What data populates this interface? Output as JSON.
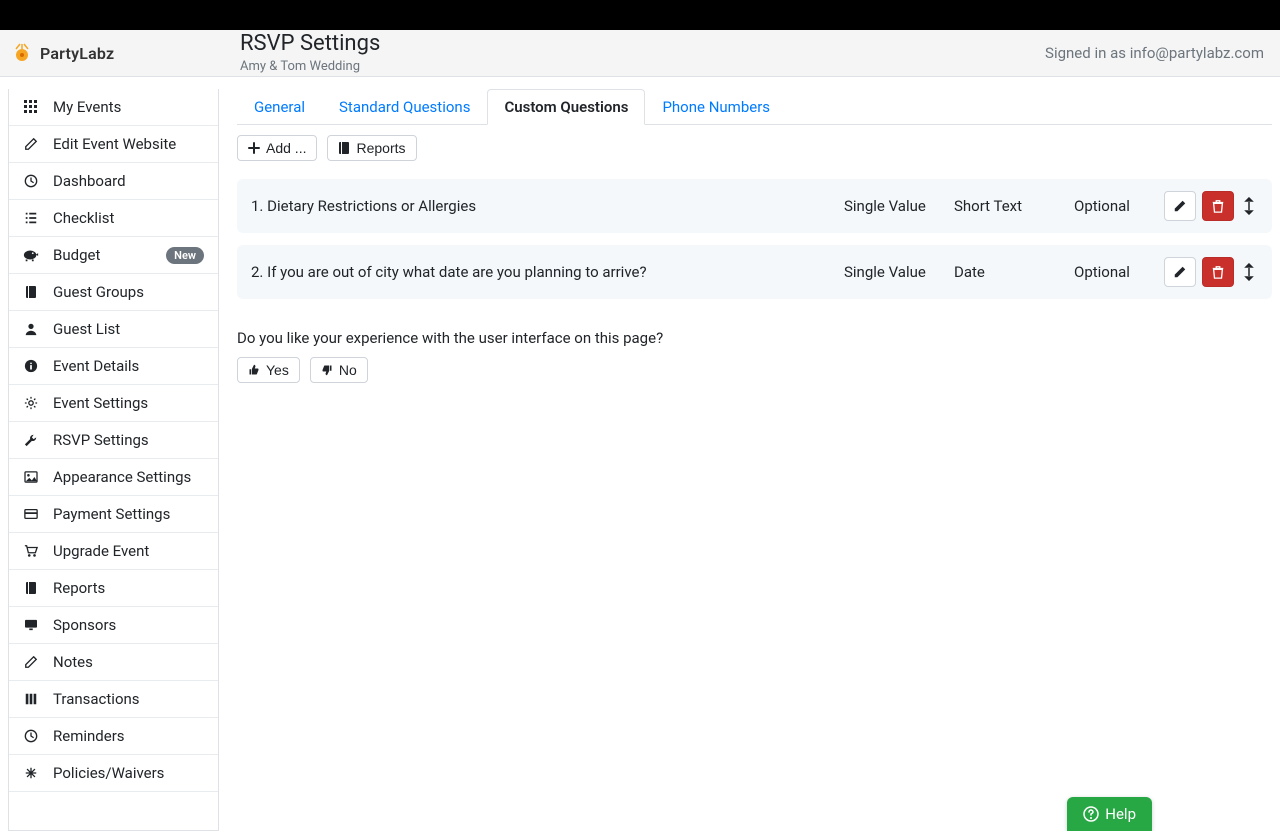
{
  "brand": {
    "name": "PartyLabz"
  },
  "header": {
    "title": "RSVP Settings",
    "event": "Amy & Tom Wedding",
    "signed_in": "Signed in as info@partylabz.com"
  },
  "sidebar": {
    "items": [
      {
        "label": "My Events",
        "icon": "grid-icon"
      },
      {
        "label": "Edit Event Website",
        "icon": "edit-icon"
      },
      {
        "label": "Dashboard",
        "icon": "clock-icon"
      },
      {
        "label": "Checklist",
        "icon": "list-icon"
      },
      {
        "label": "Budget",
        "icon": "piggy-icon",
        "badge": "New"
      },
      {
        "label": "Guest Groups",
        "icon": "book-icon"
      },
      {
        "label": "Guest List",
        "icon": "user-icon"
      },
      {
        "label": "Event Details",
        "icon": "info-icon"
      },
      {
        "label": "Event Settings",
        "icon": "gear-icon"
      },
      {
        "label": "RSVP Settings",
        "icon": "wrench-icon"
      },
      {
        "label": "Appearance Settings",
        "icon": "image-icon"
      },
      {
        "label": "Payment Settings",
        "icon": "card-icon"
      },
      {
        "label": "Upgrade Event",
        "icon": "cart-icon"
      },
      {
        "label": "Reports",
        "icon": "book-icon"
      },
      {
        "label": "Sponsors",
        "icon": "monitor-icon"
      },
      {
        "label": "Notes",
        "icon": "edit-icon"
      },
      {
        "label": "Transactions",
        "icon": "columns-icon"
      },
      {
        "label": "Reminders",
        "icon": "clock-icon"
      },
      {
        "label": "Policies/Waivers",
        "icon": "asterisk-icon"
      }
    ]
  },
  "tabs": [
    {
      "label": "General"
    },
    {
      "label": "Standard Questions"
    },
    {
      "label": "Custom Questions",
      "active": true
    },
    {
      "label": "Phone Numbers"
    }
  ],
  "toolbar": {
    "add_label": "Add ...",
    "reports_label": "Reports"
  },
  "questions": [
    {
      "idx": "1.",
      "text": "Dietary Restrictions or Allergies",
      "mode": "Single Value",
      "qtype": "Short Text",
      "req": "Optional"
    },
    {
      "idx": "2.",
      "text": "If you are out of city what date are you planning to arrive?",
      "mode": "Single Value",
      "qtype": "Date",
      "req": "Optional"
    }
  ],
  "feedback": {
    "question": "Do you like your experience with the user interface on this page?",
    "yes": "Yes",
    "no": "No"
  },
  "help": {
    "label": "Help"
  }
}
